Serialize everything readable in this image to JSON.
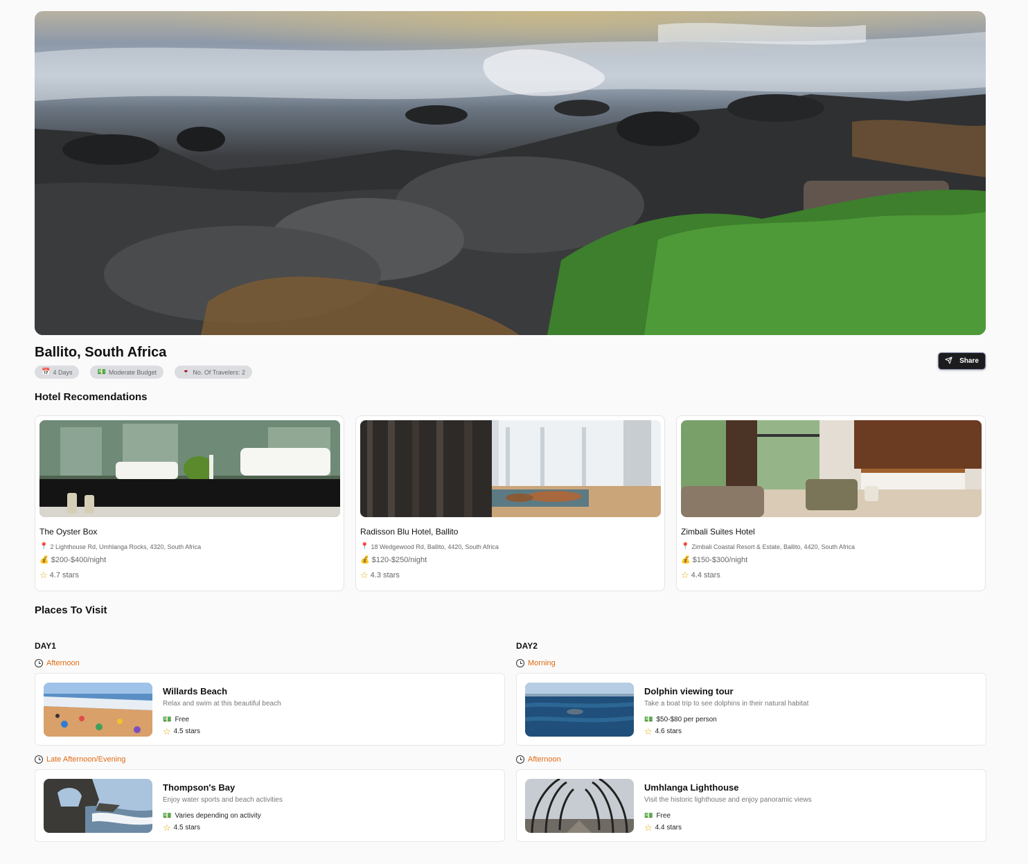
{
  "trip": {
    "title": "Ballito, South Africa",
    "chips": [
      {
        "icon": "📅",
        "icon_name": "calendar-icon",
        "label": "4 Days"
      },
      {
        "icon": "💵",
        "icon_name": "money-icon",
        "label": "Moderate Budget"
      },
      {
        "icon": "🍷",
        "icon_name": "wine-glass-icon",
        "label": "No. Of Travelers: 2"
      }
    ],
    "share_label": "Share"
  },
  "hotels_section_title": "Hotel Recomendations",
  "hotels": [
    {
      "name": "The Oyster Box",
      "address": "2 Lighthouse Rd, Umhlanga Rocks, 4320, South Africa",
      "price": "$200-$400/night",
      "rating": "4.7 stars"
    },
    {
      "name": "Radisson Blu Hotel, Ballito",
      "address": "18 Wedgewood Rd, Ballito, 4420, South Africa",
      "price": "$120-$250/night",
      "rating": "4.3 stars"
    },
    {
      "name": "Zimbali Suites Hotel",
      "address": "Zimbali Coastal Resort & Estate, Ballito, 4420, South Africa",
      "price": "$150-$300/night",
      "rating": "4.4 stars"
    }
  ],
  "places_section_title": "Places To Visit",
  "days": [
    {
      "label": "DAY1",
      "slots": [
        {
          "time": "Afternoon",
          "place": {
            "name": "Willards Beach",
            "description": "Relax and swim at this beautiful beach",
            "price": "Free",
            "rating": "4.5 stars"
          }
        },
        {
          "time": "Late Afternoon/Evening",
          "place": {
            "name": "Thompson's Bay",
            "description": "Enjoy water sports and beach activities",
            "price": "Varies depending on activity",
            "rating": "4.5 stars"
          }
        }
      ]
    },
    {
      "label": "DAY2",
      "slots": [
        {
          "time": "Morning",
          "place": {
            "name": "Dolphin viewing tour",
            "description": "Take a boat trip to see dolphins in their natural habitat",
            "price": "$50-$80 per person",
            "rating": "4.6 stars"
          }
        },
        {
          "time": "Afternoon",
          "place": {
            "name": "Umhlanga Lighthouse",
            "description": "Visit the historic lighthouse and enjoy panoramic views",
            "price": "Free",
            "rating": "4.4 stars"
          }
        }
      ]
    }
  ],
  "colors": {
    "accent_orange": "#e06a12",
    "share_bg": "#1c1c1e",
    "chip_bg": "#dcdde0"
  }
}
